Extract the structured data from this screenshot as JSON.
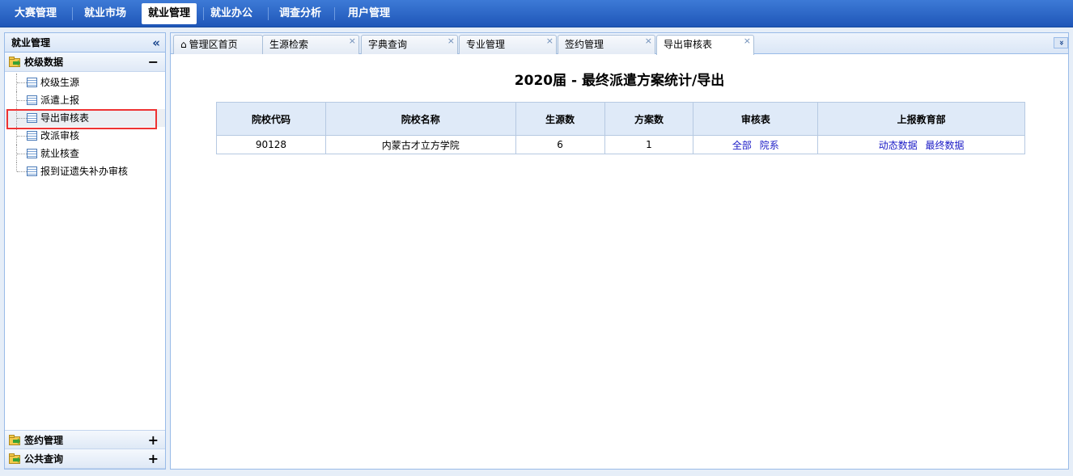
{
  "topnav": {
    "items": [
      "大赛管理",
      "就业市场",
      "就业管理",
      "就业办公",
      "调查分析",
      "用户管理"
    ],
    "active_index": 2
  },
  "sidebar": {
    "title": "就业管理",
    "collapse_icon": "double-chevron-left-icon",
    "section1": {
      "label": "校级数据",
      "toggle": "−",
      "items": [
        "校级生源",
        "派遣上报",
        "导出审核表",
        "改派审核",
        "就业核查",
        "报到证遗失补办审核"
      ],
      "selected_index": 2
    },
    "section2": {
      "label": "签约管理",
      "toggle": "+"
    },
    "section3": {
      "label": "公共查询",
      "toggle": "+"
    }
  },
  "tabs": {
    "items": [
      "管理区首页",
      "生源检索",
      "字典查询",
      "专业管理",
      "签约管理",
      "导出审核表"
    ],
    "active_index": 5,
    "close_glyph": "×",
    "scroll_glyph": "»"
  },
  "page": {
    "title": "2020届 - 最终派遣方案统计/导出"
  },
  "table": {
    "headers": [
      "院校代码",
      "院校名称",
      "生源数",
      "方案数",
      "审核表",
      "上报教育部"
    ],
    "row": {
      "code": "90128",
      "name": "内蒙古才立方学院",
      "student_count": "6",
      "plan_count": "1",
      "review_links": [
        "全部",
        "院系"
      ],
      "report_links": [
        "动态数据",
        "最终数据"
      ]
    }
  },
  "colors": {
    "nav_bg": "#2a64c6",
    "link": "#1a1ac6",
    "highlight": "#ee3333"
  }
}
